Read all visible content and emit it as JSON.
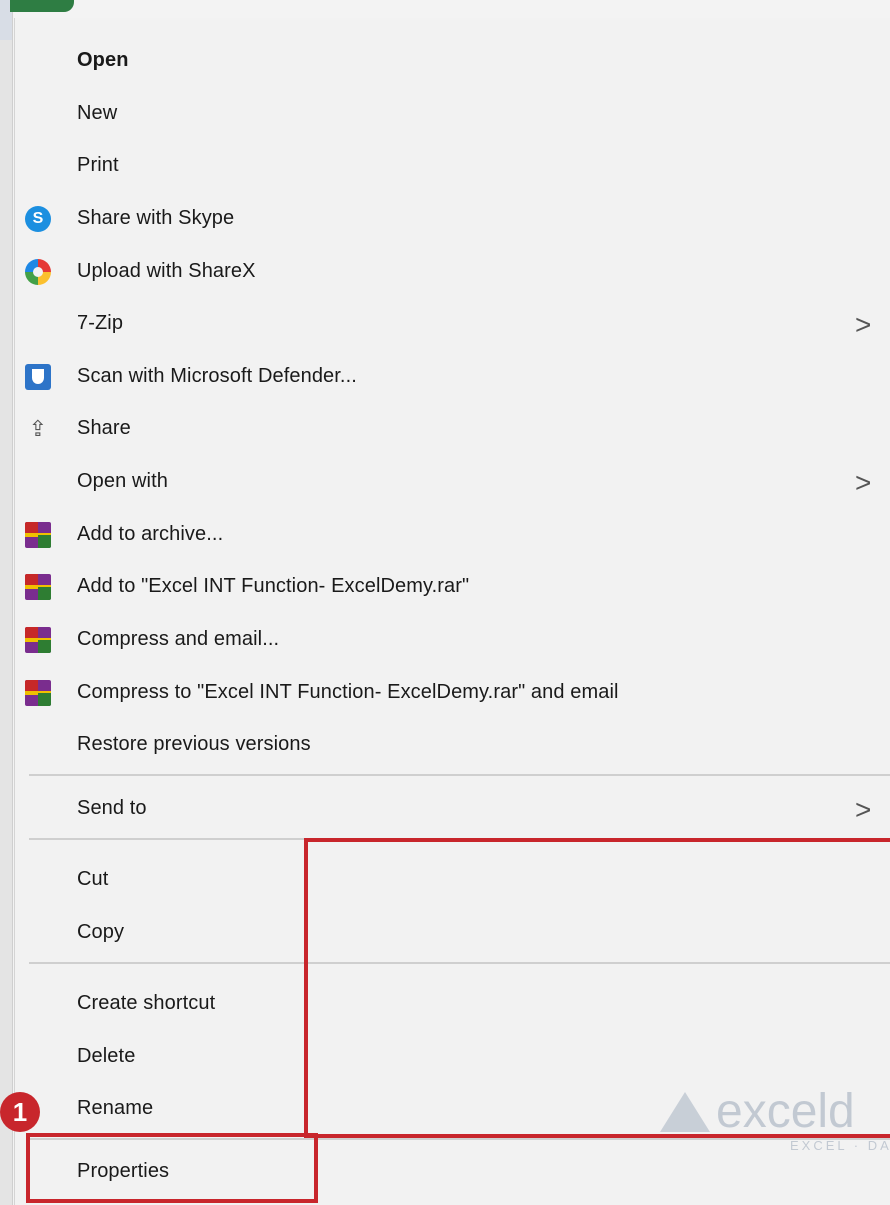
{
  "menu": {
    "items": [
      {
        "label": "Open",
        "bold": true,
        "icon": "",
        "submenu": false
      },
      {
        "label": "New",
        "icon": "",
        "submenu": false
      },
      {
        "label": "Print",
        "icon": "",
        "submenu": false
      },
      {
        "label": "Share with Skype",
        "icon": "skype-icon",
        "submenu": false
      },
      {
        "label": "Upload with ShareX",
        "icon": "sharex-icon",
        "submenu": false
      },
      {
        "label": "7-Zip",
        "icon": "",
        "submenu": true
      },
      {
        "label": "Scan with Microsoft Defender...",
        "icon": "defender-icon",
        "submenu": false
      },
      {
        "label": "Share",
        "icon": "share-icon",
        "submenu": false
      },
      {
        "label": "Open with",
        "icon": "",
        "submenu": true
      },
      {
        "label": "Add to archive...",
        "icon": "winrar-icon",
        "submenu": false
      },
      {
        "label": "Add to \"Excel INT Function- ExcelDemy.rar\"",
        "icon": "winrar-icon",
        "submenu": false
      },
      {
        "label": "Compress and email...",
        "icon": "winrar-icon",
        "submenu": false
      },
      {
        "label": "Compress to \"Excel INT Function- ExcelDemy.rar\" and email",
        "icon": "winrar-icon",
        "submenu": false
      },
      {
        "label": "Restore previous versions",
        "icon": "",
        "submenu": false
      },
      {
        "label": "Send to",
        "icon": "",
        "submenu": true
      },
      {
        "label": "Cut",
        "icon": "",
        "submenu": false
      },
      {
        "label": "Copy",
        "icon": "",
        "submenu": false
      },
      {
        "label": "Create shortcut",
        "icon": "",
        "submenu": false
      },
      {
        "label": "Delete",
        "icon": "",
        "submenu": false
      },
      {
        "label": "Rename",
        "icon": "",
        "submenu": false
      },
      {
        "label": "Properties",
        "icon": "",
        "submenu": false
      }
    ],
    "chevron": ">"
  },
  "annotation": {
    "step_badge": "1",
    "highlight_color": "#c8262c"
  },
  "icons": {
    "skype_glyph": "S",
    "share_glyph": "⇪"
  },
  "watermark": {
    "text": "exceld",
    "subtext": "EXCEL · DAT"
  }
}
